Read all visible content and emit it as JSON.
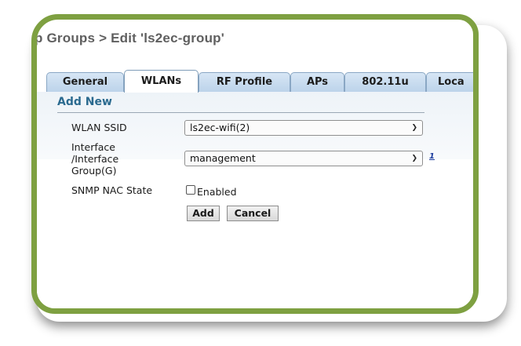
{
  "page": {
    "title": "p Groups > Edit  'ls2ec-group'"
  },
  "tabs": [
    {
      "label": "General"
    },
    {
      "label": "WLANs"
    },
    {
      "label": "RF Profile"
    },
    {
      "label": "APs"
    },
    {
      "label": "802.11u"
    },
    {
      "label": "Loca"
    }
  ],
  "active_tab": "WLANs",
  "add_new": {
    "heading": "Add New",
    "wlan_ssid": {
      "label": "WLAN SSID",
      "value": "ls2ec-wifi(2)"
    },
    "interface": {
      "label_lines": [
        "Interface",
        "/Interface",
        "Group(G)"
      ],
      "value": "management",
      "help": "1"
    },
    "snmp": {
      "label": "SNMP NAC State",
      "checkbox_label": "Enabled",
      "checked": false
    },
    "add_label": "Add",
    "cancel_label": "Cancel"
  },
  "colors": {
    "frame": "#7ea041",
    "section_title": "#2b6a8f",
    "tab_bg": "#c9dcee"
  }
}
